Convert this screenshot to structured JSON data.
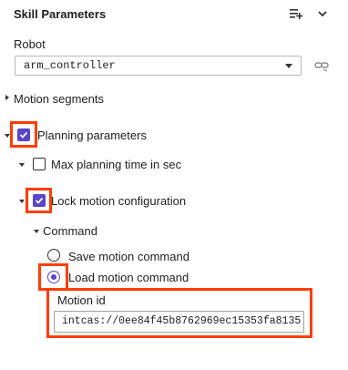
{
  "panel": {
    "title": "Skill Parameters",
    "header_icons": [
      "playlist-add-icon",
      "chevron-down-icon"
    ]
  },
  "robot": {
    "label": "Robot",
    "selected": "arm_controller",
    "link_icon": "link-icon"
  },
  "tree": {
    "motion_segments": "Motion segments",
    "planning_parameters": "Planning parameters",
    "max_planning_time": "Max planning time in sec",
    "lock_motion_configuration": "Lock motion configuration",
    "command": "Command",
    "save_motion_command": "Save motion command",
    "load_motion_command": "Load motion command",
    "motion_id_label": "Motion id",
    "motion_id_value": "intcas://0ee84f45b8762969ec15353fa8135"
  },
  "state": {
    "planning_parameters_checked": true,
    "max_planning_time_checked": false,
    "lock_motion_configuration_checked": true,
    "selected_command": "load"
  },
  "colors": {
    "accent": "#5a45c9",
    "highlight": "#ff3d00"
  }
}
